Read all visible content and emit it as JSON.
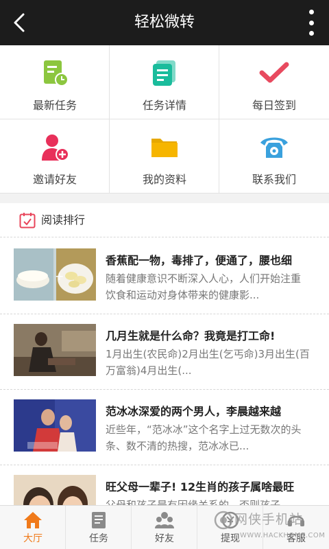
{
  "header": {
    "title": "轻松微转"
  },
  "menu": [
    {
      "label": "最新任务",
      "icon": "new-task-icon",
      "color": "#8cc63f"
    },
    {
      "label": "任务详情",
      "icon": "task-detail-icon",
      "color": "#1abc9c"
    },
    {
      "label": "每日签到",
      "icon": "checkmark-icon",
      "color": "#e84a5f"
    },
    {
      "label": "邀请好友",
      "icon": "invite-user-icon",
      "color": "#e8305a"
    },
    {
      "label": "我的资料",
      "icon": "folder-icon",
      "color": "#f6b500"
    },
    {
      "label": "联系我们",
      "icon": "phone-icon",
      "color": "#3aa1dd"
    }
  ],
  "reading": {
    "title": "阅读排行",
    "articles": [
      {
        "title": "香蕉配一物，毒排了，便通了，腰也细",
        "desc": "随着健康意识不断深入人心，人们开始注重饮食和运动对身体带来的健康影..."
      },
      {
        "title": "几月生就是什么命？我竟是打工命!",
        "desc": "1月出生(农民命)2月出生(乞丐命)3月出生(百万富翁)4月出生(..."
      },
      {
        "title": "范冰冰深爱的两个男人，李晨越来越",
        "desc": "近些年，“范冰冰”这个名字上过无数次的头条、数不清的热搜，范冰冰已..."
      },
      {
        "title": "旺父母一辈子! 12生肖的孩子属啥最旺",
        "desc": "父母和孩子是有因缘关系的，否则孩子..."
      }
    ]
  },
  "tabs": [
    {
      "label": "大厅",
      "icon": "home-icon"
    },
    {
      "label": "任务",
      "icon": "task-list-icon"
    },
    {
      "label": "好友",
      "icon": "friends-icon"
    },
    {
      "label": "提现",
      "icon": "withdraw-icon"
    },
    {
      "label": "客服",
      "icon": "service-icon"
    }
  ],
  "watermark": {
    "line1": "网侠手机站",
    "line2": "WWW.HACKHOME.COM"
  },
  "colors": {
    "header_bg": "#1c1c1c",
    "active_tab": "#f07a1a",
    "calendar_icon": "#e8445a"
  }
}
